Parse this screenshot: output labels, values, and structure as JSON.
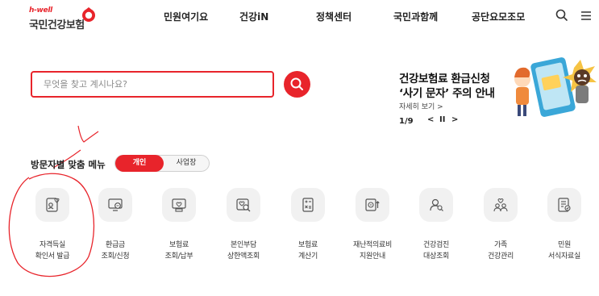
{
  "colors": {
    "brand": "#e8242b",
    "icon": "#555555",
    "tile": "#f1f1f1"
  },
  "logo": {
    "sub": "h-well",
    "main": "국민건강보험"
  },
  "nav": {
    "items": [
      "민원여기요",
      "건강iN",
      "정책센터",
      "국민과함께",
      "공단요모조모"
    ],
    "search_icon": "search-icon",
    "menu_icon": "hamburger-menu-icon"
  },
  "search": {
    "placeholder": "무엇을 찾고 계시나요?",
    "value": "",
    "button_icon": "search-icon"
  },
  "banner": {
    "line1": "건강보험료 환급신청",
    "line2": "‘사기 문자’ 주의 안내",
    "more": "자세히 보기 >",
    "page": "1/9",
    "prev": "<",
    "pause": "II",
    "next": ">"
  },
  "menu": {
    "title": "방문자별 맞춤 메뉴",
    "toggle_on": "개인",
    "toggle_off": "사업장",
    "items": [
      {
        "l1": "자격득실",
        "l2": "확인서 발급",
        "icon": "certificate-icon"
      },
      {
        "l1": "환급금",
        "l2": "조회/신청",
        "icon": "refund-icon"
      },
      {
        "l1": "보험료",
        "l2": "조회/납부",
        "icon": "premium-payment-icon"
      },
      {
        "l1": "본인부담",
        "l2": "상한액조회",
        "icon": "copay-ceiling-icon"
      },
      {
        "l1": "보험료",
        "l2": "계산기",
        "icon": "calculator-icon"
      },
      {
        "l1": "재난적의료비",
        "l2": "지원안내",
        "icon": "medical-aid-icon"
      },
      {
        "l1": "건강검진",
        "l2": "대상조회",
        "icon": "health-checkup-icon"
      },
      {
        "l1": "가족",
        "l2": "건강관리",
        "icon": "family-care-icon"
      },
      {
        "l1": "민원",
        "l2": "서식자료실",
        "icon": "forms-library-icon"
      }
    ]
  }
}
